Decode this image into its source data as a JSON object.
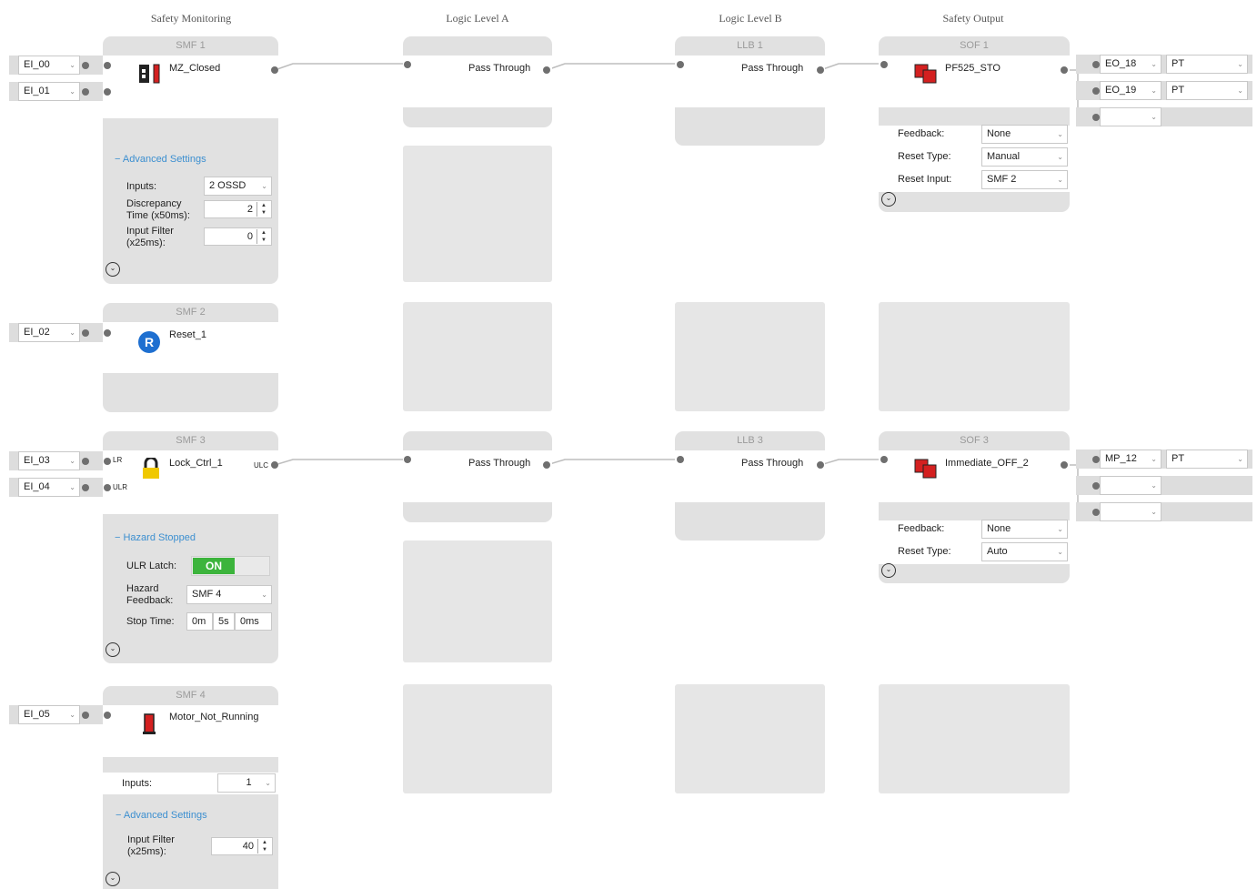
{
  "columns": {
    "c1": "Safety Monitoring",
    "c2": "Logic Level A",
    "c3": "Logic Level B",
    "c4": "Safety Output"
  },
  "smf1": {
    "header": "SMF 1",
    "name": "MZ_Closed",
    "in1": "EI_00",
    "in2": "EI_01",
    "adv": "Advanced Settings",
    "inputs_label": "Inputs:",
    "inputs_val": "2 OSSD",
    "disc_label": "Discrepancy Time (x50ms):",
    "disc_val": "2",
    "filter_label": "Input Filter (x25ms):",
    "filter_val": "0"
  },
  "smf2": {
    "header": "SMF 2",
    "name": "Reset_1",
    "in1": "EI_02",
    "icon_letter": "R"
  },
  "smf3": {
    "header": "SMF 3",
    "name": "Lock_Ctrl_1",
    "in1": "EI_03",
    "in2": "EI_04",
    "port_lr": "LR",
    "port_ulr": "ULR",
    "port_ulc": "ULC",
    "section": "Hazard Stopped",
    "latch_label": "ULR Latch:",
    "latch_val": "ON",
    "feedback_label": "Hazard Feedback:",
    "feedback_val": "SMF 4",
    "stop_label": "Stop Time:",
    "stop_m": "0m",
    "stop_s": "5s",
    "stop_ms": "0ms"
  },
  "smf4": {
    "header": "SMF 4",
    "name": "Motor_Not_Running",
    "in1": "EI_05",
    "inputs_label": "Inputs:",
    "inputs_val": "1",
    "adv": "Advanced Settings",
    "filter_label": "Input Filter (x25ms):",
    "filter_val": "40"
  },
  "la1": {
    "name": "Pass Through"
  },
  "la3": {
    "name": "Pass Through"
  },
  "llb1": {
    "header": "LLB 1",
    "name": "Pass Through"
  },
  "llb3": {
    "header": "LLB 3",
    "name": "Pass Through"
  },
  "sof1": {
    "header": "SOF 1",
    "name": "PF525_STO",
    "out1": "EO_18",
    "out1t": "PT",
    "out2": "EO_19",
    "out2t": "PT",
    "feedback_label": "Feedback:",
    "feedback_val": "None",
    "reset_type_label": "Reset Type:",
    "reset_type_val": "Manual",
    "reset_in_label": "Reset Input:",
    "reset_in_val": "SMF 2"
  },
  "sof3": {
    "header": "SOF 3",
    "name": "Immediate_OFF_2",
    "out1": "MP_12",
    "out1t": "PT",
    "feedback_label": "Feedback:",
    "feedback_val": "None",
    "reset_type_label": "Reset Type:",
    "reset_type_val": "Auto"
  },
  "colors": {
    "accent": "#3c8fd0",
    "on_green": "#3cb43c",
    "icon_red": "#d42020",
    "lock_yellow": "#f0c800",
    "reset_blue": "#1e6fd0"
  }
}
